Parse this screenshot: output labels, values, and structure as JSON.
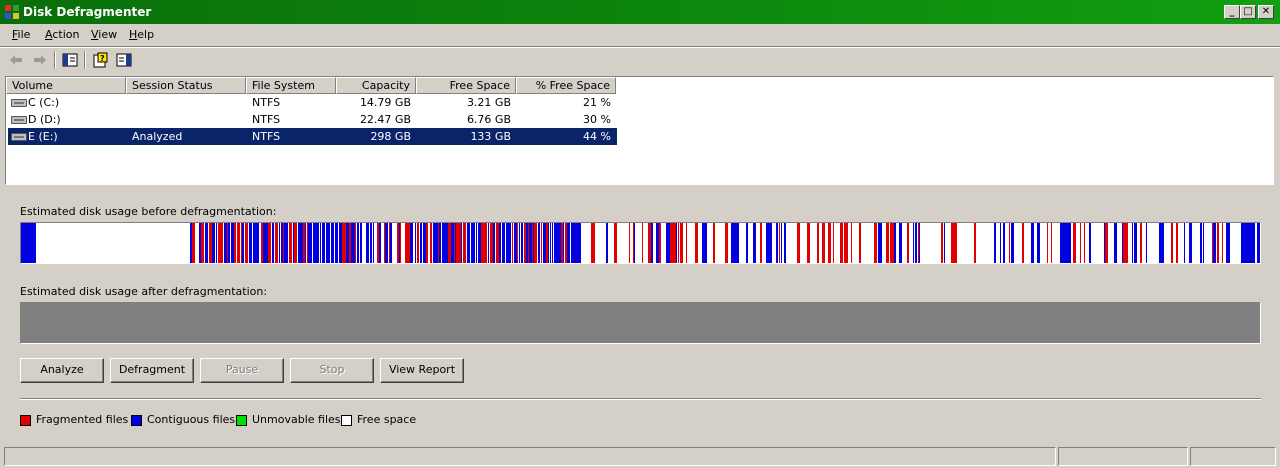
{
  "window": {
    "title": "Disk Defragmenter",
    "minimize_glyph": "_",
    "maximize_glyph": "□",
    "close_glyph": "✕",
    "title_color": "#0d8a0d"
  },
  "menu": {
    "items": [
      "File",
      "Action",
      "View",
      "Help"
    ]
  },
  "toolbar": {
    "icons": [
      "back-arrow-icon",
      "forward-arrow-icon",
      "show-hide-console-tree-icon",
      "help-icon",
      "properties-icon"
    ]
  },
  "volumes": {
    "columns": [
      "Volume",
      "Session Status",
      "File System",
      "Capacity",
      "Free Space",
      "% Free Space"
    ],
    "rows": [
      {
        "volume": "C (C:)",
        "status": "",
        "fs": "NTFS",
        "capacity": "14.79 GB",
        "free": "3.21 GB",
        "pct": "21 %",
        "selected": false
      },
      {
        "volume": "D (D:)",
        "status": "",
        "fs": "NTFS",
        "capacity": "22.47 GB",
        "free": "6.76 GB",
        "pct": "30 %",
        "selected": false
      },
      {
        "volume": "E (E:)",
        "status": "Analyzed",
        "fs": "NTFS",
        "capacity": "298 GB",
        "free": "133 GB",
        "pct": "44 %",
        "selected": true
      }
    ],
    "selection_color": "#0a246a"
  },
  "analysis": {
    "before_label": "Estimated disk usage before defragmentation:",
    "after_label": "Estimated disk usage after defragmentation:",
    "after_fill_color": "#808080"
  },
  "buttons": {
    "analyze": "Analyze",
    "defragment": "Defragment",
    "pause": "Pause",
    "stop": "Stop",
    "view_report": "View Report"
  },
  "legend": [
    {
      "label": "Fragmented files",
      "color": "#e00000"
    },
    {
      "label": "Contiguous files",
      "color": "#0000e0"
    },
    {
      "label": "Unmovable files",
      "color": "#00e000"
    },
    {
      "label": "Free space",
      "color": "#ffffff"
    }
  ]
}
